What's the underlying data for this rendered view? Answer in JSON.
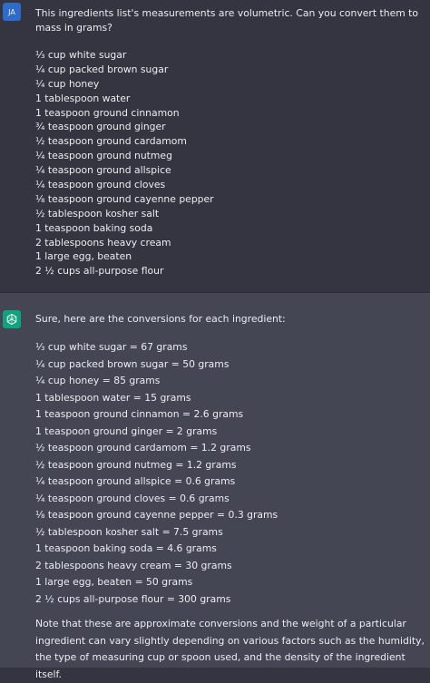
{
  "user_message": {
    "avatar_initials": "JA",
    "prompt": "This ingredients list's measurements are volumetric.  Can you convert them to mass in grams?",
    "ingredients": [
      "⅓ cup white sugar",
      "¼ cup packed brown sugar",
      "¼ cup honey",
      "1 tablespoon water",
      "1 teaspoon ground cinnamon",
      "¾ teaspoon ground ginger",
      "½ teaspoon ground cardamom",
      "¼ teaspoon ground nutmeg",
      "¼ teaspoon ground allspice",
      "¼ teaspoon ground cloves",
      "⅛ teaspoon ground cayenne pepper",
      "½ tablespoon kosher salt",
      "1 teaspoon baking soda",
      "2 tablespoons heavy cream",
      "1 large egg, beaten",
      "2 ½ cups all-purpose flour"
    ]
  },
  "assistant_message": {
    "avatar_icon": "openai-logo-icon",
    "intro": "Sure, here are the conversions for each ingredient:",
    "conversions": [
      "⅓ cup white sugar = 67 grams",
      "¼ cup packed brown sugar = 50 grams",
      "¼ cup honey = 85 grams",
      "1 tablespoon water = 15 grams",
      "1 teaspoon ground cinnamon = 2.6 grams",
      "1 teaspoon ground ginger = 2 grams",
      "½ teaspoon ground cardamom = 1.2 grams",
      "½ teaspoon ground nutmeg = 1.2 grams",
      "¼ teaspoon ground allspice = 0.6 grams",
      "¼ teaspoon ground cloves = 0.6 grams",
      "⅛ teaspoon ground cayenne pepper = 0.3 grams",
      "½ tablespoon kosher salt = 7.5 grams",
      "1 teaspoon baking soda = 4.6 grams",
      "2 tablespoons heavy cream = 30 grams",
      "1 large egg, beaten = 50 grams",
      "2 ½ cups all-purpose flour = 300 grams"
    ],
    "note": "Note that these are approximate conversions and the weight of a particular ingredient can vary slightly depending on various factors such as the humidity, the type of measuring cup or spoon used, and the density of the ingredient itself."
  },
  "colors": {
    "user_bg": "#343541",
    "assistant_bg": "#444654",
    "text": "#ececf1",
    "user_avatar": "#2f6bc8",
    "gpt_avatar": "#10a37f"
  }
}
